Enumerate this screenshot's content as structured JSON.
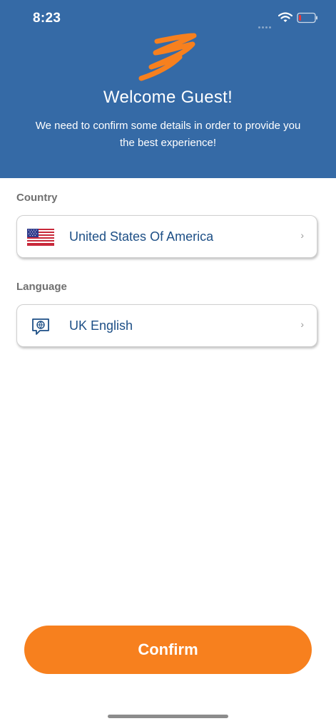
{
  "status_bar": {
    "time": "8:23"
  },
  "header": {
    "title": "Welcome Guest!",
    "subtitle_line1": "We need to confirm some details in order to provide you",
    "subtitle_line2": "the best experience!",
    "background_color": "#356aa6"
  },
  "country": {
    "label": "Country",
    "value": "United States Of America",
    "icon": "us-flag-icon"
  },
  "language": {
    "label": "Language",
    "value": "UK English",
    "icon": "language-chat-icon"
  },
  "confirm": {
    "label": "Confirm",
    "color": "#f7801e"
  }
}
